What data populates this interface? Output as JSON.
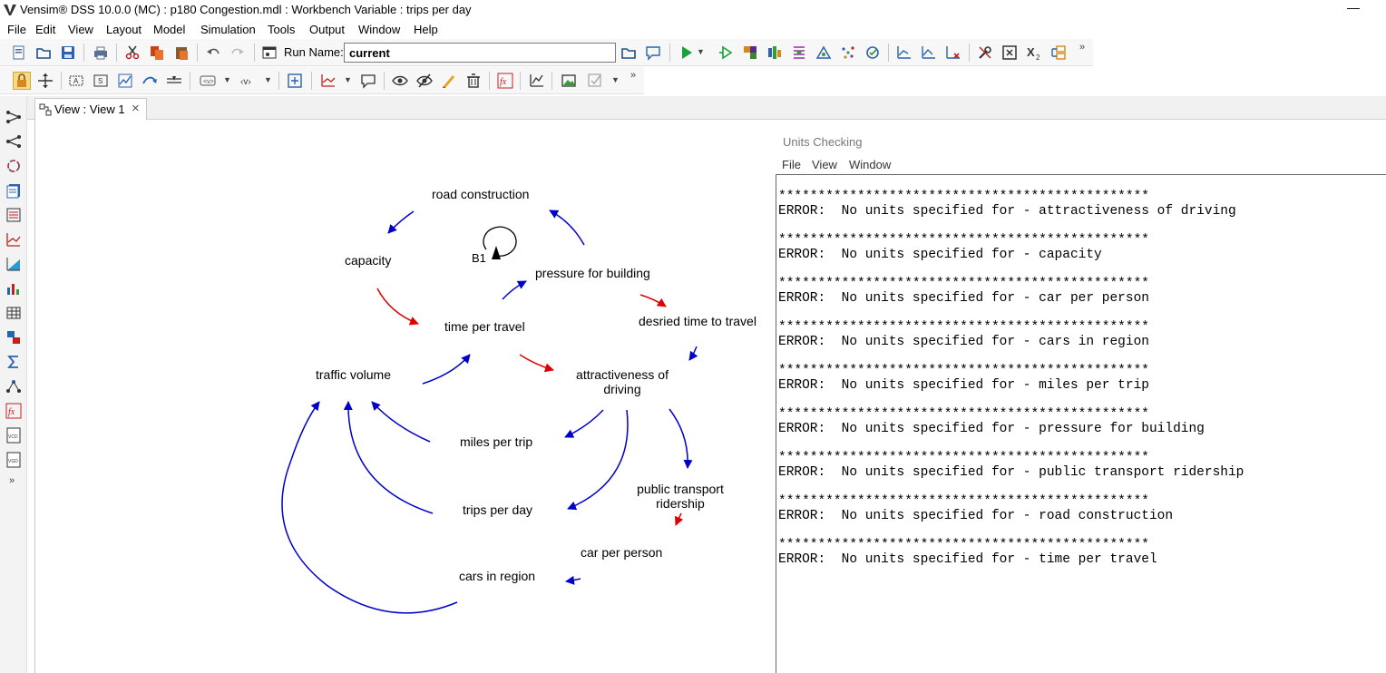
{
  "window": {
    "title": "Vensim® DSS 10.0.0 (MC) : p180 Congestion.mdl : Workbench Variable : trips per day",
    "minimize": "—"
  },
  "menu": [
    "File",
    "Edit",
    "View",
    "Layout",
    "Model",
    "Simulation",
    "Tools",
    "Output",
    "Window",
    "Help"
  ],
  "toolbar": {
    "run_name_label": "Run Name:",
    "run_name_value": "current",
    "overflow": "»"
  },
  "tab": {
    "label": "View : View 1",
    "close": "×"
  },
  "colors": {
    "link_positive": "#0000cc",
    "link_highlight": "#e00000"
  },
  "diagram": {
    "variables": {
      "road_construction": "road construction",
      "capacity": "capacity",
      "pressure_for_building": "pressure for building",
      "time_per_travel": "time per travel",
      "desried_time_to_travel": "desried time to travel",
      "traffic_volume": "traffic volume",
      "attractiveness_line1": "attractiveness of",
      "attractiveness_line2": "driving",
      "miles_per_trip": "miles per trip",
      "public_transport_line1": "public transport",
      "public_transport_line2": "ridership",
      "trips_per_day": "trips per day",
      "car_per_person": "car per person",
      "cars_in_region": "cars in region"
    },
    "loop_label": "B1"
  },
  "units_checking": {
    "title": "Units Checking",
    "menu": [
      "File",
      "View",
      "Window"
    ],
    "lines": [
      "***********************************************",
      "ERROR:  No units specified for - attractiveness of driving",
      "***********************************************",
      "ERROR:  No units specified for - capacity",
      "***********************************************",
      "ERROR:  No units specified for - car per person",
      "***********************************************",
      "ERROR:  No units specified for - cars in region",
      "***********************************************",
      "ERROR:  No units specified for - miles per trip",
      "***********************************************",
      "ERROR:  No units specified for - pressure for building",
      "***********************************************",
      "ERROR:  No units specified for - public transport ridership",
      "***********************************************",
      "ERROR:  No units specified for - road construction",
      "***********************************************",
      "ERROR:  No units specified for - time per travel"
    ]
  }
}
